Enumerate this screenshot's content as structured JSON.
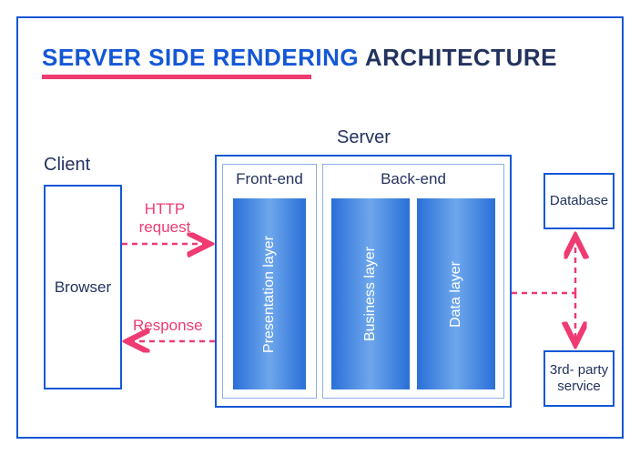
{
  "title": {
    "highlight": "SERVER SIDE RENDERING",
    "rest": " ARCHITECTURE"
  },
  "sections": {
    "client": "Client",
    "server": "Server"
  },
  "client_box": {
    "label": "Browser"
  },
  "server_box": {
    "front_end": "Front-end",
    "back_end": "Back-end",
    "layers": {
      "presentation": "Presentation layer",
      "business": "Business layer",
      "data": "Data layer"
    }
  },
  "external": {
    "database": "Database",
    "third_party": "3rd- party service"
  },
  "arrows": {
    "request": "HTTP request",
    "response": "Response"
  },
  "colors": {
    "primary": "#1457d6",
    "accent": "#ef3b72",
    "text": "#23335f"
  }
}
